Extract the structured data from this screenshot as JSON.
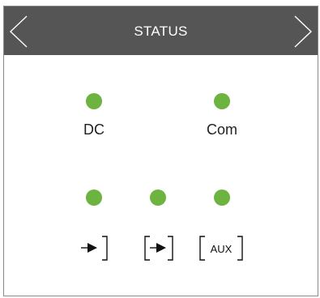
{
  "header": {
    "title": "STATUS",
    "prev_icon": "chevron-left-icon",
    "next_icon": "chevron-right-icon"
  },
  "indicators": {
    "dc": {
      "label": "DC",
      "state": "on",
      "color": "#6db33f"
    },
    "com": {
      "label": "Com",
      "state": "on",
      "color": "#6db33f"
    }
  },
  "inputs": [
    {
      "icon": "input-arrow-icon",
      "state": "on",
      "color": "#6db33f"
    },
    {
      "icon": "boxed-arrow-icon",
      "state": "on",
      "color": "#6db33f"
    },
    {
      "icon": "aux-icon",
      "label": "AUX",
      "state": "on",
      "color": "#6db33f"
    }
  ],
  "colors": {
    "header_bg": "#555555",
    "header_text": "#ffffff",
    "led_on": "#6db33f"
  }
}
